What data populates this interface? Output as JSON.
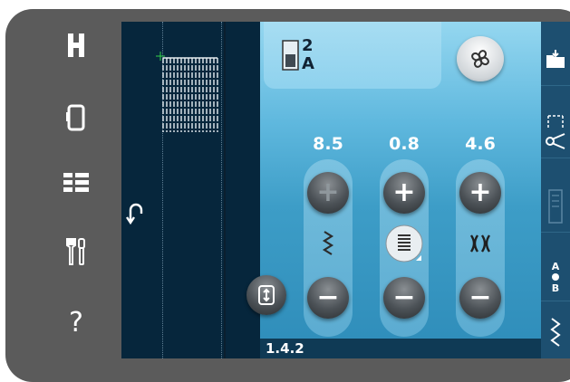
{
  "left_column_icons": [
    "presser-foot-icon",
    "hoop-icon",
    "menu-grid-icon",
    "tools-icon",
    "help-icon"
  ],
  "help_label": "?",
  "stitch_number": "2",
  "stitch_category": "A",
  "values": {
    "stitch_width": "8.5",
    "stitch_density": "0.8",
    "stitch_length": "4.6"
  },
  "buttons": {
    "plus": "+",
    "minus": "−"
  },
  "status": {
    "stitch_id": "1.4.2"
  },
  "right_strip_icons": [
    "load-file-icon",
    "cut-icon",
    "disabled-icon",
    "alphabet-icon",
    "stitch-play-icon"
  ],
  "colors": {
    "panel_top": "#95d7f0",
    "panel_bottom": "#2e8cb9",
    "screen_dark": "#06263c",
    "bezel": "#5b5b5b"
  }
}
